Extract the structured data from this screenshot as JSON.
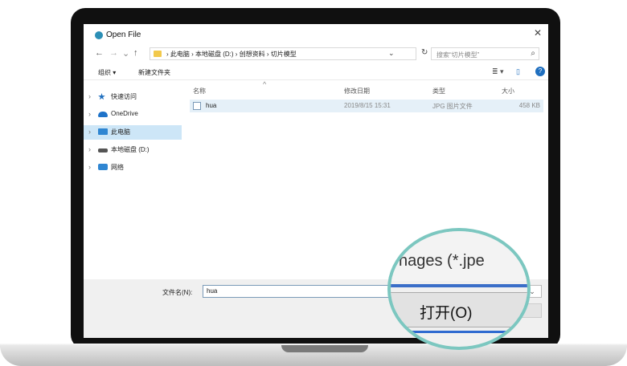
{
  "dialog": {
    "title": "Open File",
    "close_glyph": "✕"
  },
  "navigation": {
    "back": "←",
    "forward": "→",
    "recent": "⌄",
    "up": "↑",
    "breadcrumb": "› 此电脑 › 本地磁盘 (D:) › 创想资料 › 切片模型",
    "dropdown": "⌄",
    "refresh": "↻",
    "search_placeholder": "搜索“切片模型”",
    "search_icon": "⌕"
  },
  "toolbar": {
    "organize": "组织 ▾",
    "new_folder": "新建文件夹",
    "view_icon": "≣ ▾",
    "pane_icon": "▯",
    "help": "?"
  },
  "sidebar": {
    "items": [
      {
        "label": "快速访问",
        "icon": "star-icon",
        "color": "#1f6fbf",
        "selected": false
      },
      {
        "label": "OneDrive",
        "icon": "cloud-icon",
        "color": "#1e73c9",
        "selected": false
      },
      {
        "label": "此电脑",
        "icon": "computer-icon",
        "color": "#2f86d2",
        "selected": true
      },
      {
        "label": "本地磁盘 (D:)",
        "icon": "drive-icon",
        "color": "#555555",
        "selected": false
      },
      {
        "label": "网络",
        "icon": "network-icon",
        "color": "#2f86d2",
        "selected": false
      }
    ]
  },
  "columns": {
    "name": "名称",
    "date": "修改日期",
    "type": "类型",
    "size": "大小",
    "sort_caret": "^"
  },
  "files": [
    {
      "name": "hua",
      "date": "2019/8/15 15:31",
      "type": "JPG 图片文件",
      "size": "458 KB"
    }
  ],
  "footer": {
    "filename_label": "文件名(N):",
    "filename_value": "hua",
    "filetype_dd": "⌄"
  },
  "magnifier": {
    "filter_text": "nages (*.jpe",
    "open_button": "打开(O)"
  }
}
